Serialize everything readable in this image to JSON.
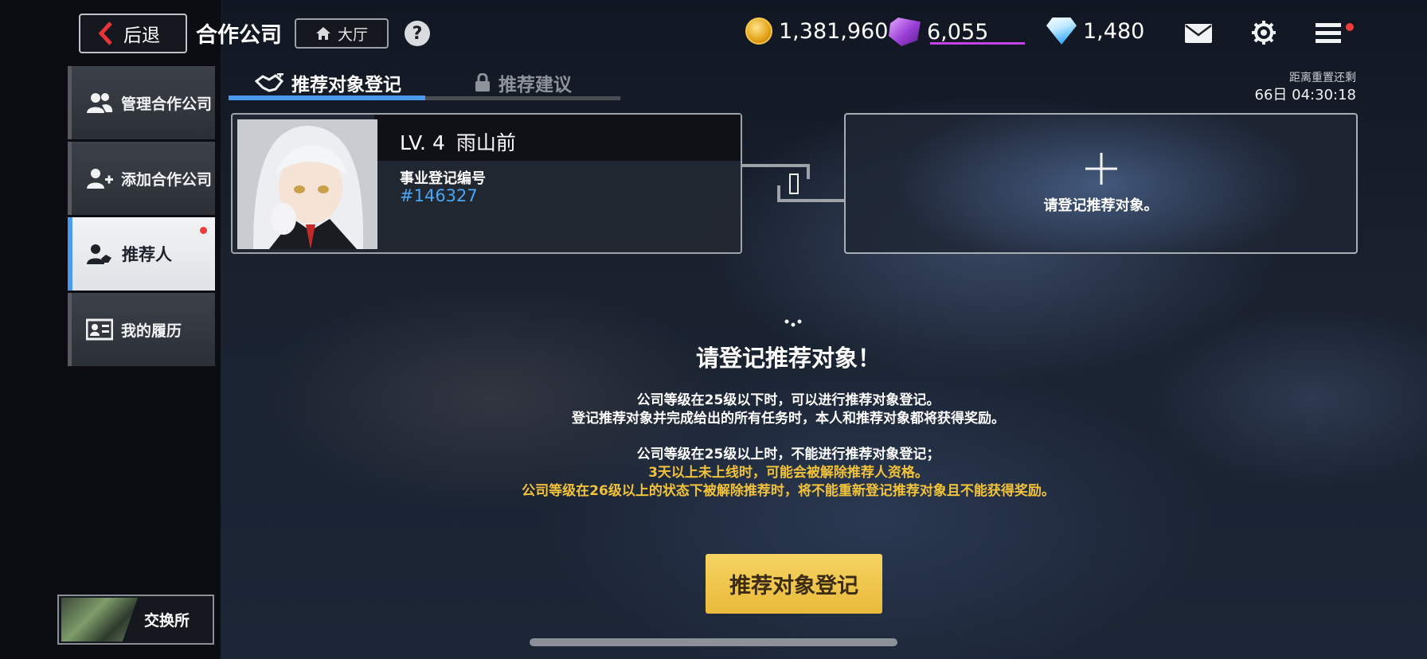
{
  "header": {
    "back_label": "后退",
    "page_title": "合作公司",
    "lobby_label": "大厅",
    "help_label": "?"
  },
  "currencies": [
    {
      "name": "gold-coin-icon",
      "value": "1,381,960"
    },
    {
      "name": "purple-gem-icon",
      "value": "6,055"
    },
    {
      "name": "blue-diamond-icon",
      "value": "1,480"
    }
  ],
  "sidebar": {
    "items": [
      {
        "label": "管理合作公司",
        "icon": "people-icon"
      },
      {
        "label": "添加合作公司",
        "icon": "add-person-icon"
      },
      {
        "label": "推荐人",
        "icon": "handshake-person-icon",
        "active": true,
        "notification": true
      },
      {
        "label": "我的履历",
        "icon": "profile-card-icon"
      }
    ],
    "exchange_label": "交换所"
  },
  "tabs": [
    {
      "label": "推荐对象登记",
      "icon": "handshake-icon",
      "active": true
    },
    {
      "label": "推荐建议",
      "icon": "lock-icon",
      "locked": true
    }
  ],
  "reset": {
    "label": "距离重置还剩",
    "time": "66日  04:30:18"
  },
  "member_card": {
    "level": "LV. 4",
    "name": "雨山前",
    "reg_label": "事业登记编号",
    "reg_id": "#146327"
  },
  "add_card": {
    "text": "请登记推荐对象。"
  },
  "info": {
    "title": "请登记推荐对象！",
    "lines": [
      "公司等级在25级以下时，可以进行推荐对象登记。",
      "登记推荐对象并完成给出的所有任务时，本人和推荐对象都将获得奖励。",
      "公司等级在25级以上时，不能进行推荐对象登记；",
      "3天以上未上线时，可能会被解除推荐人资格。",
      "公司等级在26级以上的状态下被解除推荐时，将不能重新登记推荐对象且不能获得奖励。"
    ]
  },
  "register_button": "推荐对象登记",
  "colors": {
    "accent_blue": "#4a9bf0",
    "warning_yellow": "#f1c23a",
    "button_yellow": "#f6d462",
    "notification_red": "#ef3b3b"
  }
}
